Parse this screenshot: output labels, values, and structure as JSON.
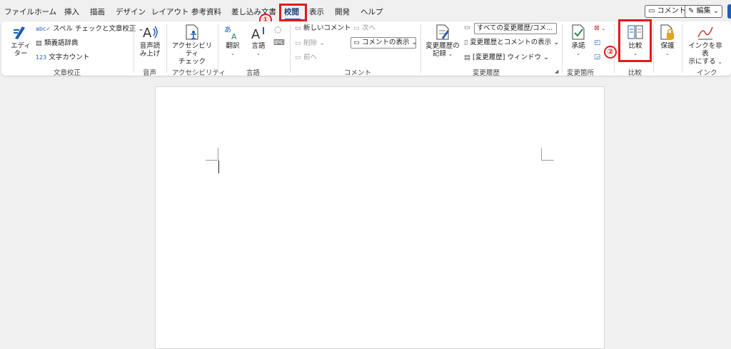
{
  "tabs": [
    "ファイル",
    "ホーム",
    "挿入",
    "描画",
    "デザイン",
    "レイアウト",
    "参考資料",
    "差し込み文書",
    "校閲",
    "表示",
    "開発",
    "ヘルプ"
  ],
  "active_tab": "校閲",
  "top_buttons": {
    "comment": "コメント",
    "edit": "編集"
  },
  "annotations": {
    "step1": "①",
    "step2": "②"
  },
  "ribbon": {
    "proofing": {
      "editor": "エディ\nター",
      "spelling": "スペル チェックと文章校正",
      "thesaurus": "類義語辞典",
      "word_count": "文字カウント",
      "group": "文章校正"
    },
    "speech": {
      "read_aloud": "音声読\nみ上げ",
      "group": "音声"
    },
    "accessibility": {
      "check": "アクセシビリティ\nチェック",
      "group": "アクセシビリティ"
    },
    "language": {
      "translate": "翻訳",
      "language": "言語",
      "group": "言語"
    },
    "comments": {
      "new": "新しいコメント",
      "delete": "削除",
      "prev": "前へ",
      "next": "次へ",
      "show": "コメントの表示",
      "group": "コメント"
    },
    "tracking": {
      "track_changes": "変更履歴の\n記録",
      "markup_select": "すべての変更履歴/コメ...",
      "show_markup": "変更履歴とコメントの表示",
      "pane": "[変更履歴] ウィンドウ",
      "group": "変更履歴"
    },
    "changes": {
      "accept": "承諾",
      "group": "変更箇所"
    },
    "compare": {
      "compare": "比較",
      "group": "比較"
    },
    "protect": {
      "protect": "保護"
    },
    "ink": {
      "hide_ink": "インクを非表\n示にする",
      "group": "インク"
    }
  }
}
